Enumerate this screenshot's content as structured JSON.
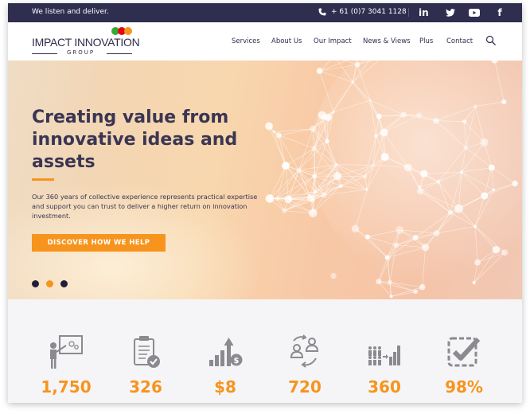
{
  "topbar": {
    "tagline": "We listen and deliver.",
    "phone": "+ 61 (0)7 3041 1128",
    "social": [
      "linkedin-icon",
      "twitter-icon",
      "youtube-icon",
      "facebook-icon"
    ]
  },
  "logo": {
    "name": "IMPACT INNOVATION",
    "subtitle": "GROUP",
    "dot_colors": [
      "#39a935",
      "#e30613",
      "#f7941d"
    ]
  },
  "nav": {
    "items": [
      "Services",
      "About Us",
      "Our Impact",
      "News & Views",
      "Plus",
      "Contact"
    ]
  },
  "hero": {
    "title": "Creating value from innovative ideas and assets",
    "body": "Our 360 years of collective experience represents practical expertise and support you can trust to deliver a higher return on innovation investment.",
    "cta": "DISCOVER HOW WE HELP",
    "slides": 3,
    "active_slide": 2
  },
  "stats": [
    {
      "icon": "presentation-icon",
      "value": "1,750"
    },
    {
      "icon": "clipboard-check-icon",
      "value": "326"
    },
    {
      "icon": "growth-dollar-icon",
      "value": "$8"
    },
    {
      "icon": "people-exchange-icon",
      "value": "720"
    },
    {
      "icon": "team-growth-icon",
      "value": "360"
    },
    {
      "icon": "checkbox-icon",
      "value": "98%"
    }
  ],
  "colors": {
    "navy": "#2f2e4f",
    "accent": "#f7941d",
    "icon_grey": "#8a8a8f"
  }
}
